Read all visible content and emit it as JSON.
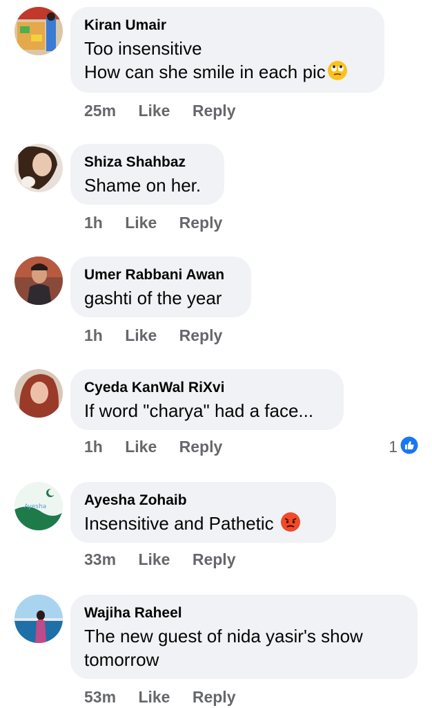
{
  "comments": [
    {
      "name": "Kiran Umair",
      "lines": [
        "Too insensitive",
        "How can she smile in each pic"
      ],
      "emoji": "eye-roll-emoji",
      "time": "25m",
      "like": "Like",
      "reply": "Reply",
      "avatar_colors": [
        "#c0392b",
        "#f4d03f",
        "#3a7bd5"
      ]
    },
    {
      "name": "Shiza Shahbaz",
      "lines": [
        "Shame on her."
      ],
      "time": "1h",
      "like": "Like",
      "reply": "Reply",
      "avatar_colors": [
        "#6b4a3a",
        "#e8d6c8",
        "#2b1e18"
      ]
    },
    {
      "name": "Umer Rabbani Awan",
      "lines": [
        "gashti of the year"
      ],
      "time": "1h",
      "like": "Like",
      "reply": "Reply",
      "avatar_colors": [
        "#a04a3a",
        "#3a2a2a",
        "#d6a080"
      ]
    },
    {
      "name": "Cyeda KanWal RiXvi",
      "lines": [
        "If word \"charya\" had a face..."
      ],
      "time": "1h",
      "like": "Like",
      "reply": "Reply",
      "reactions": "1",
      "avatar_colors": [
        "#b0442e",
        "#e8b8a0",
        "#5a2418"
      ]
    },
    {
      "name": "Ayesha Zohaib",
      "lines": [
        "Insensitive and Pathetic"
      ],
      "emoji": "angry-face-emoji",
      "time": "33m",
      "like": "Like",
      "reply": "Reply",
      "avatar_colors": [
        "#e8f4ee",
        "#1f7a4a",
        "#5aa0c8"
      ],
      "avatar_text": "Ayesha"
    },
    {
      "name": "Wajiha Raheel",
      "lines": [
        "The new guest of nida yasir's show",
        "tomorrow"
      ],
      "time": "53m",
      "like": "Like",
      "reply": "Reply",
      "avatar_colors": [
        "#87bde8",
        "#1f6fa8",
        "#c04a8a"
      ]
    }
  ],
  "colors": {
    "bubble": "#f0f2f5",
    "meta": "#65676b",
    "like_blue": "#1877f2"
  }
}
